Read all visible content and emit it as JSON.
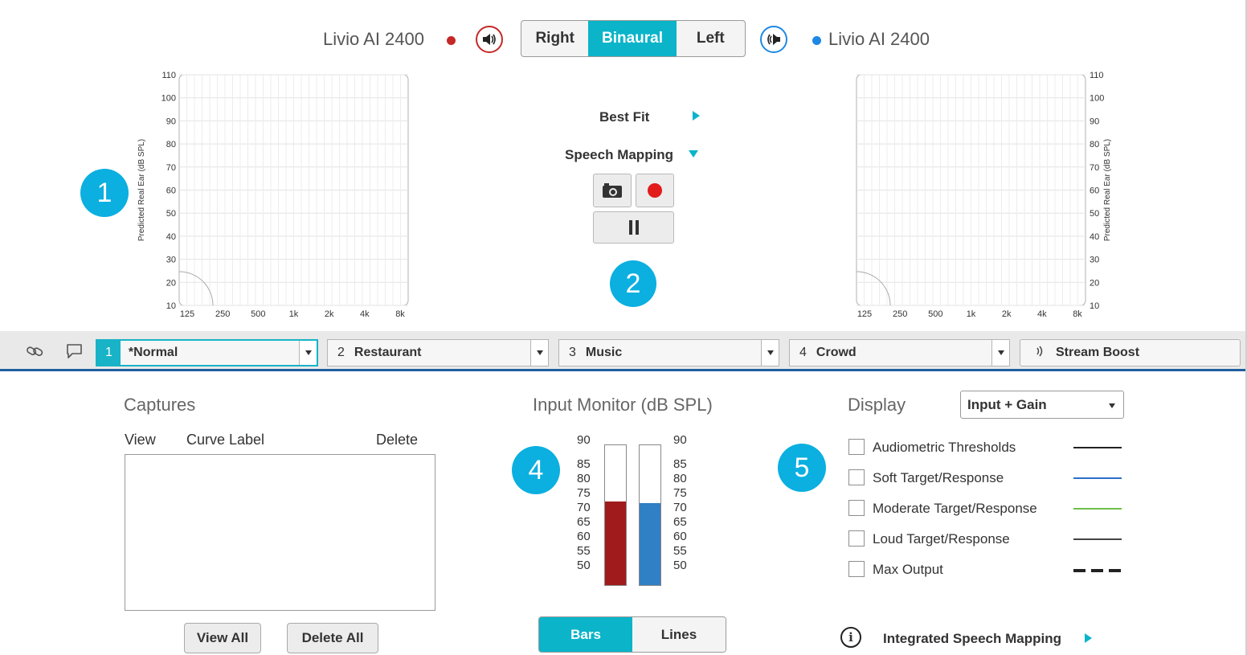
{
  "header": {
    "right_device": "Livio AI 2400",
    "left_device": "Livio AI 2400",
    "right_color": "#c62828",
    "left_color": "#1e88e5",
    "right_speaker_icon": "speaker-icon",
    "left_speaker_icon": "speaker-icon",
    "ear_toggle": {
      "options": [
        "Right",
        "Binaural",
        "Left"
      ],
      "selected": "Binaural"
    }
  },
  "charts": {
    "y_ticks": [
      "110",
      "100",
      "90",
      "80",
      "70",
      "60",
      "50",
      "40",
      "30",
      "20",
      "10"
    ],
    "x_ticks": [
      "125",
      "250",
      "500",
      "1k",
      "2k",
      "4k",
      "8k"
    ],
    "ylabel": "Predicted Real Ear (dB SPL)"
  },
  "controls": {
    "best_fit": "Best Fit",
    "speech_mapping": "Speech Mapping",
    "camera_icon": "camera-icon",
    "record_icon": "record-icon",
    "pause_icon": "pause-icon"
  },
  "callouts": [
    "1",
    "2",
    "3",
    "4",
    "5"
  ],
  "memory_bar": {
    "link_icon": "link-icon",
    "comment_icon": "comment-icon",
    "memories": [
      {
        "num": "1",
        "name": "*Normal"
      },
      {
        "num": "2",
        "name": "Restaurant"
      },
      {
        "num": "3",
        "name": "Music"
      },
      {
        "num": "4",
        "name": "Crowd"
      }
    ],
    "stream_boost": "Stream Boost",
    "stream_icon": "stream-icon"
  },
  "captures": {
    "title": "Captures",
    "col_view": "View",
    "col_label": "Curve Label",
    "col_delete": "Delete",
    "view_all": "View All",
    "delete_all": "Delete All"
  },
  "input_monitor": {
    "title": "Input Monitor (dB SPL)",
    "scale": [
      "90",
      "85",
      "80",
      "75",
      "70",
      "65",
      "60",
      "55",
      "50"
    ],
    "right_level": 74,
    "left_level": 73.5,
    "range": [
      50,
      90
    ],
    "right_color": "#a01c1c",
    "left_color": "#2f80c4",
    "bars_label": "Bars",
    "lines_label": "Lines",
    "selected": "Bars"
  },
  "display": {
    "title": "Display",
    "select_value": "Input + Gain",
    "options": [
      {
        "label": "Audiometric Thresholds",
        "line": "solid-black"
      },
      {
        "label": "Soft Target/Response",
        "line": "solid-blue"
      },
      {
        "label": "Moderate Target/Response",
        "line": "solid-green"
      },
      {
        "label": "Loud Target/Response",
        "line": "solid-gray"
      },
      {
        "label": "Max Output",
        "line": "dashed-black"
      }
    ],
    "info_icon": "info-icon",
    "integrated_link": "Integrated Speech Mapping"
  }
}
